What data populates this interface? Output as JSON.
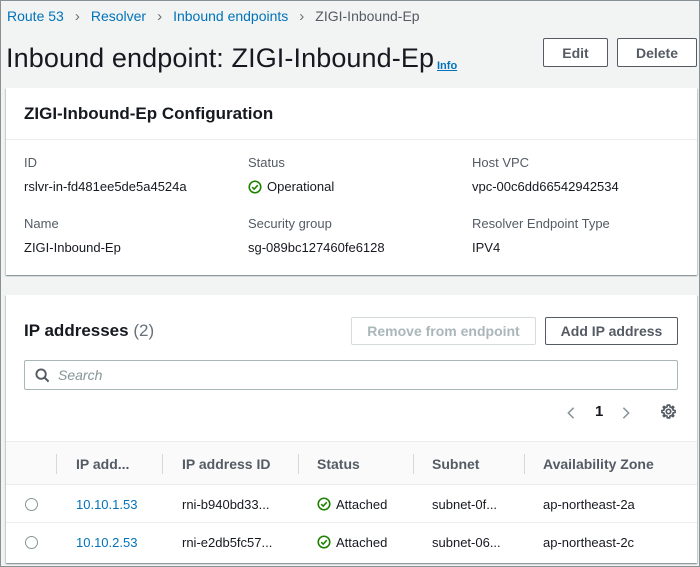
{
  "breadcrumb": {
    "items": [
      "Route 53",
      "Resolver",
      "Inbound endpoints"
    ],
    "current": "ZIGI-Inbound-Ep"
  },
  "header": {
    "title": "Inbound endpoint: ZIGI-Inbound-Ep",
    "info": "Info",
    "edit_label": "Edit",
    "delete_label": "Delete"
  },
  "config": {
    "title": "ZIGI-Inbound-Ep Configuration",
    "fields": {
      "id_label": "ID",
      "id_value": "rslvr-in-fd481ee5de5a4524a",
      "status_label": "Status",
      "status_value": "Operational",
      "vpc_label": "Host VPC",
      "vpc_value": "vpc-00c6dd66542942534",
      "name_label": "Name",
      "name_value": "ZIGI-Inbound-Ep",
      "sg_label": "Security group",
      "sg_value": "sg-089bc127460fe6128",
      "type_label": "Resolver Endpoint Type",
      "type_value": "IPV4"
    }
  },
  "ip_section": {
    "title": "IP addresses",
    "count": "(2)",
    "remove_label": "Remove from endpoint",
    "add_label": "Add IP address",
    "search_placeholder": "Search",
    "page": "1",
    "columns": [
      "IP add...",
      "IP address ID",
      "Status",
      "Subnet",
      "Availability Zone"
    ],
    "rows": [
      {
        "ip": "10.10.1.53",
        "id": "rni-b940bd33...",
        "status": "Attached",
        "subnet": "subnet-0f...",
        "az": "ap-northeast-2a"
      },
      {
        "ip": "10.10.2.53",
        "id": "rni-e2db5fc57...",
        "status": "Attached",
        "subnet": "subnet-06...",
        "az": "ap-northeast-2c"
      }
    ]
  },
  "colors": {
    "link": "#0073bb",
    "success": "#1d8102",
    "text": "#16191f",
    "muted": "#545b64",
    "background": "#f2f3f3"
  },
  "icons": [
    "chevron-right-icon",
    "check-circle-icon",
    "search-icon",
    "chevron-left-icon",
    "gear-icon",
    "radio-icon"
  ]
}
